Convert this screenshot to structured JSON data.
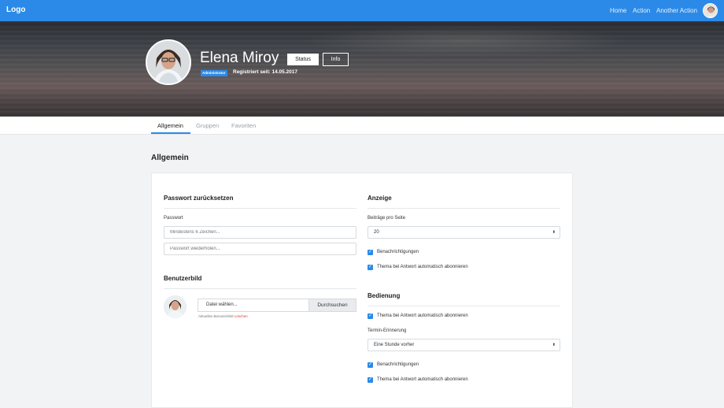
{
  "navbar": {
    "logo": "Logo",
    "links": [
      "Home",
      "Action",
      "Another Action"
    ]
  },
  "profile": {
    "name": "Elena Miroy",
    "status_button": "Status",
    "info_button": "Info",
    "badge": "Administrator",
    "registered": "Registriert seit: 14.05.2017"
  },
  "tabs": [
    "Allgemein",
    "Gruppen",
    "Favoriten"
  ],
  "section_title": "Allgemein",
  "password": {
    "title": "Passwort zurücksetzen",
    "label": "Passwort",
    "placeholder1": "Mindestens 6 Zeichen...",
    "placeholder2": "Passwort wiederholen..."
  },
  "user_image": {
    "title": "Benutzerbild",
    "file_placeholder": "Datei wählen...",
    "browse": "Durchsuchen",
    "hint": "Aktuelles Benutzerbild",
    "delete": "Löschen"
  },
  "display": {
    "title": "Anzeige",
    "posts_label": "Beiträge pro Seite",
    "posts_value": "20",
    "check1": "Benachrichtigungen",
    "check2": "Thema bei Antwort automatisch abonnieren"
  },
  "operation": {
    "title": "Bedienung",
    "check1": "Thema bei Antwort automatisch abonnieren",
    "reminder_label": "Termin-Erinnerung",
    "reminder_value": "Eine Stunde vorher",
    "check2": "Benachrichtigungen",
    "check3": "Thema bei Antwort automatisch abonnieren"
  },
  "colors": {
    "accent": "#2b8ae8",
    "danger": "#e03a3a"
  }
}
